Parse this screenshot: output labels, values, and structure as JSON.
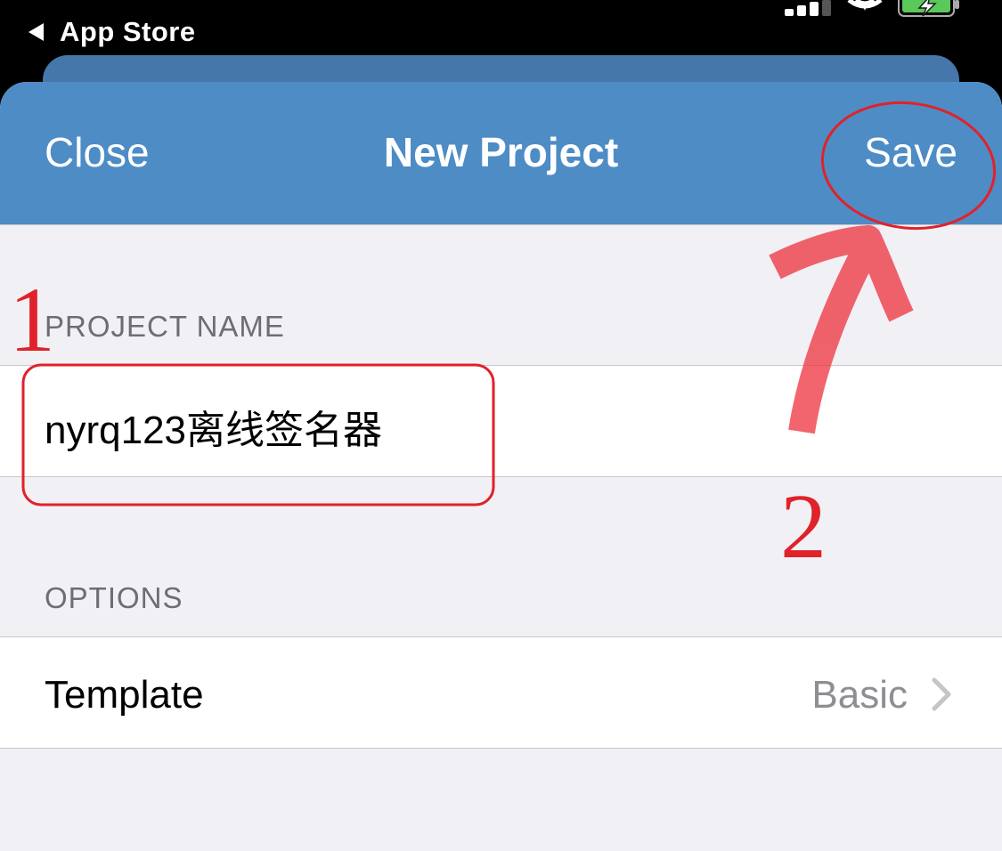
{
  "status_bar": {
    "back_label": "App Store",
    "back_icon": "back-triangle-icon",
    "signal_icon": "cellular-signal-icon",
    "wifi_icon": "wifi-icon",
    "battery_icon": "battery-charging-icon"
  },
  "nav": {
    "close_label": "Close",
    "title": "New Project",
    "save_label": "Save"
  },
  "sections": {
    "project_name_header": "PROJECT NAME",
    "project_name_value": "nyrq123离线签名器",
    "options_header": "OPTIONS"
  },
  "options": {
    "template_label": "Template",
    "template_value": "Basic",
    "chevron_icon": "chevron-right-icon"
  },
  "annotations": {
    "step_one": "1",
    "step_two": "2",
    "arrow_icon": "arrow-up-icon"
  },
  "colors": {
    "nav_background": "#4e8cc6",
    "grouped_background": "#f1f0f5",
    "annotation_red": "#e0222a",
    "battery_green": "#5ac85a"
  }
}
